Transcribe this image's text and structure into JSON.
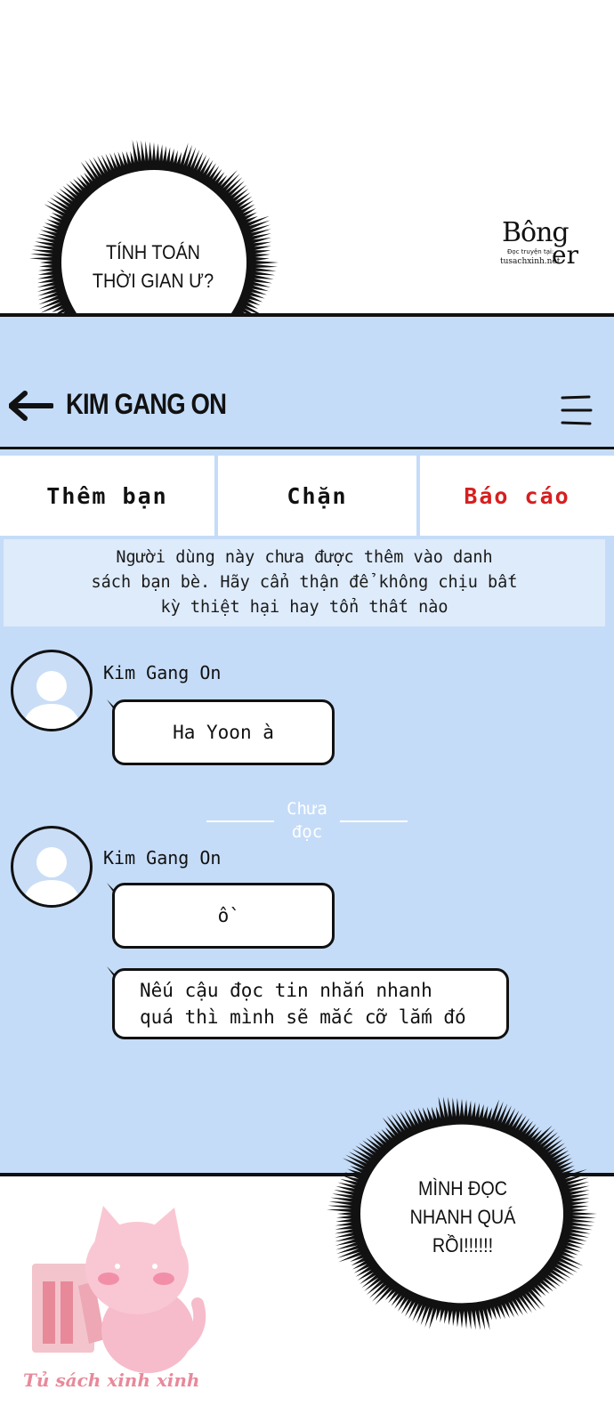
{
  "speech_top": {
    "text": "TÍNH TOÁN\nTHỜI GIAN Ư?"
  },
  "speech_bottom": {
    "text": "MÌNH ĐỌC\nNHANH QUÁ\nRỒI!!!!!!"
  },
  "logo": {
    "name": "Bông",
    "name_tail": "er",
    "tagline": "Đọc truyện tại:",
    "url": "tusachxinh.net"
  },
  "header": {
    "title": "KIM GANG ON",
    "back_icon": "arrow-left-icon",
    "menu_icon": "hamburger-icon"
  },
  "actions": {
    "add_friend": "Thêm bạn",
    "block": "Chặn",
    "report": "Báo cáo",
    "report_color": "#d61f1f"
  },
  "warning": {
    "text": "Người dùng này chưa được thêm vào danh\nsách bạn bè. Hãy cẩn thận để không chịu bất\nkỳ thiệt hại hay tổn thất nào"
  },
  "messages": [
    {
      "sender": "Kim Gang On",
      "text": "Ha Yoon à"
    },
    {
      "sender": "Kim Gang On",
      "text": "ồ"
    },
    {
      "text_line1": "Nếu cậu đọc tin nhắn nhanh",
      "text_line2": "quá thì mình sẽ mắc cỡ lắm đó"
    }
  ],
  "unread_divider": {
    "line1": "Chưa",
    "line2": "đọc"
  },
  "watermark": {
    "text": "Tủ sách xinh xinh"
  },
  "colors": {
    "panel_bg": "#c5dcf8",
    "warning_bg": "#deebfb",
    "outline": "#111111"
  }
}
